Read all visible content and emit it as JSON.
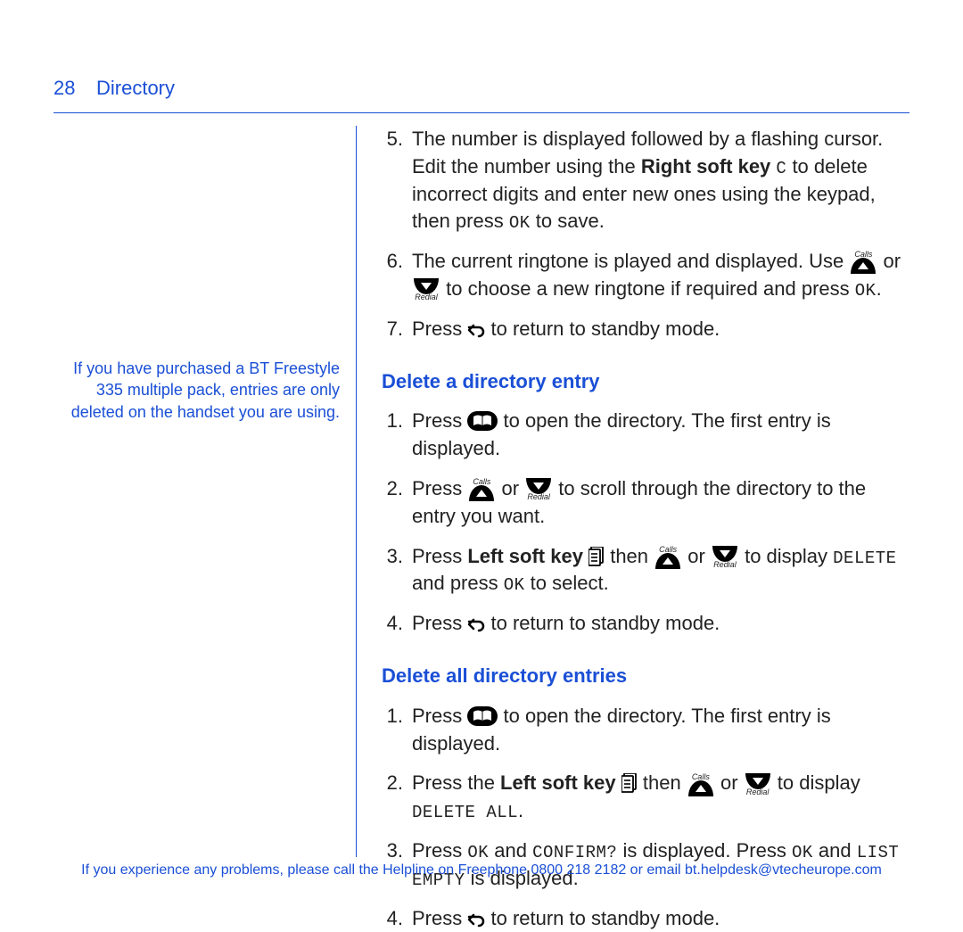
{
  "page_number": "28",
  "section_title": "Directory",
  "side_note": "If you have purchased a BT Freestyle 335 multiple pack, entries are only deleted on the handset you are using.",
  "cont": {
    "s5_a": "The number is displayed followed by a flashing cursor. Edit the number using the ",
    "s5_b": "Right soft key",
    "s5_c": " to delete incorrect digits and enter new ones using the keypad, then press ",
    "s5_d": " to save.",
    "s6_a": "The current ringtone is played and displayed. Use ",
    "s6_b": " or ",
    "s6_c": " to choose a new ringtone if required and press ",
    "s6_d": ".",
    "s7_a": "Press ",
    "s7_b": " to return to standby mode."
  },
  "lcd": {
    "C": "C",
    "OK": "OK",
    "DELETE": "DELETE",
    "DELETE_ALL": "DELETE ALL",
    "CONFIRM": "CONFIRM?",
    "LIST_EMPTY": "LIST EMPTY"
  },
  "icons": {
    "up_label": "Calls",
    "down_label": "Redial"
  },
  "del_entry": {
    "heading": "Delete a directory entry",
    "s1_a": "Press ",
    "s1_b": " to open the directory. The first entry is displayed.",
    "s2_a": "Press ",
    "s2_b": " or ",
    "s2_c": " to scroll through the directory to the entry you want.",
    "s3_a": "Press ",
    "s3_b": "Left soft key",
    "s3_c": " then ",
    "s3_d": " or ",
    "s3_e": " to display ",
    "s3_f": " and press ",
    "s3_g": " to select.",
    "s4_a": "Press ",
    "s4_b": " to return to standby mode."
  },
  "del_all": {
    "heading": "Delete all directory entries",
    "s1_a": "Press ",
    "s1_b": " to open the directory. The first entry is displayed.",
    "s2_a": "Press the ",
    "s2_b": "Left soft key",
    "s2_c": " then ",
    "s2_d": " or ",
    "s2_e": " to display ",
    "s2_f": ".",
    "s3_a": "Press ",
    "s3_b": " and ",
    "s3_c": " is displayed. Press ",
    "s3_d": " and ",
    "s3_e": " is displayed.",
    "s4_a": "Press ",
    "s4_b": " to return to standby mode."
  },
  "footer": "If you experience any problems, please call the Helpline on Freephone 0800 218 2182 or email bt.helpdesk@vtecheurope.com"
}
